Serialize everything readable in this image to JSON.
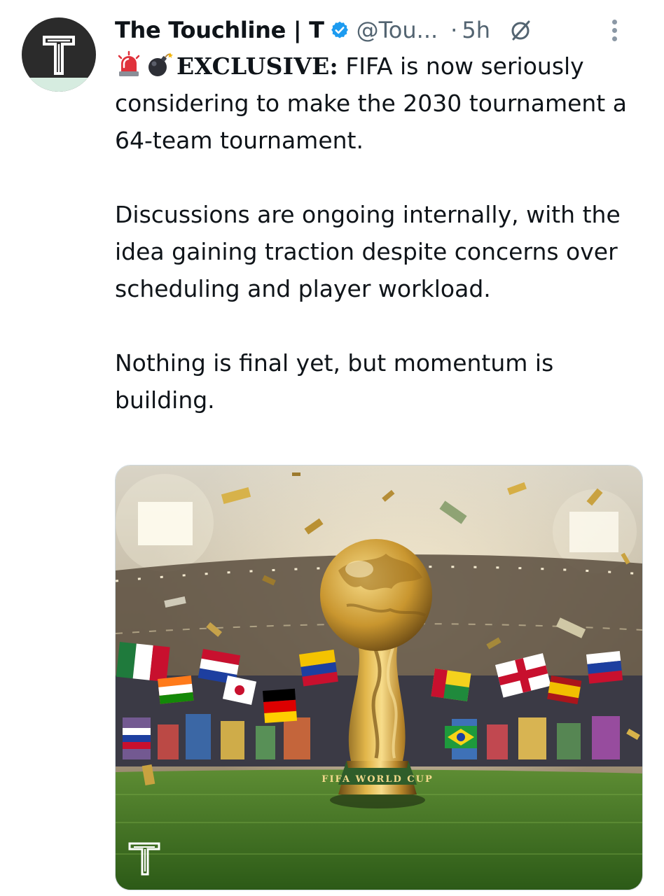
{
  "author": {
    "display_name": "The Touchline | T",
    "handle": "@Tou...",
    "separator": "·",
    "time": "5h",
    "avatar_icon": "touchline-t-logo",
    "verified_color": "#1d9bf0"
  },
  "tweet": {
    "lead_emojis": [
      "police-light-emoji",
      "bomb-emoji"
    ],
    "headline_label": "EXCLUSIVE:",
    "headline_rest": " FIFA is now seriously considering to make the 2030 tournament a 64-team tournament.",
    "paragraph_2": "Discussions are ongoing internally, with the idea gaining traction despite concerns over scheduling and player workload.",
    "paragraph_3": "Nothing is final yet, but momentum is building."
  },
  "media": {
    "trophy_base_text": "FIFA WORLD CUP",
    "watermark_icon": "touchline-t-logo"
  },
  "colors": {
    "text_primary": "#0f1419",
    "text_secondary": "#536471",
    "grass": "#2f6a1f",
    "gold": "#c99a2e"
  }
}
